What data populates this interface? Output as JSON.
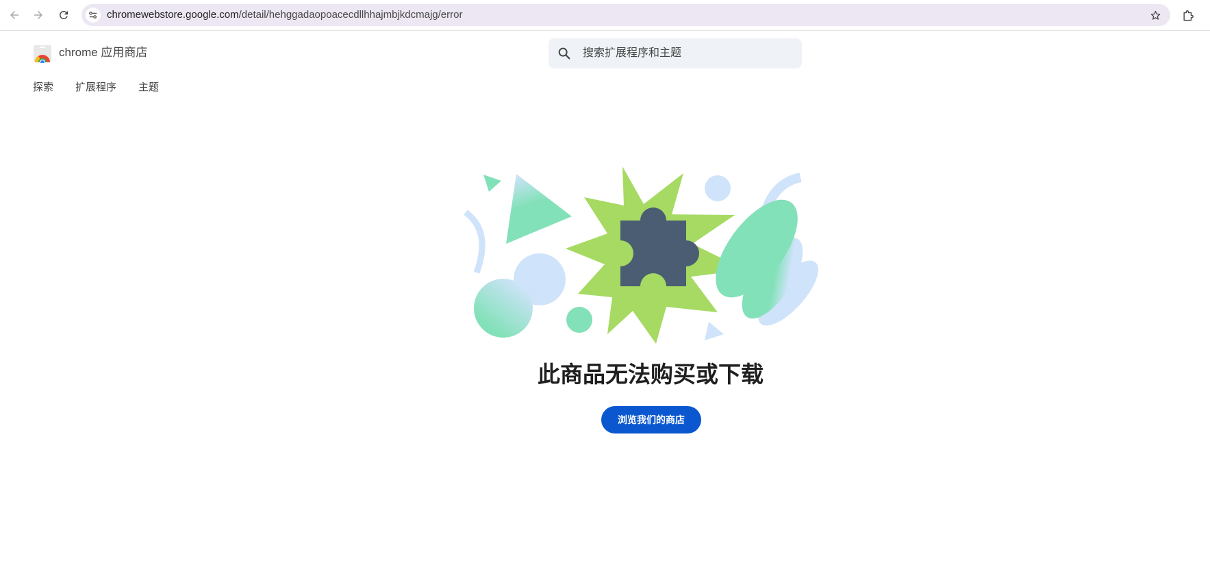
{
  "browser": {
    "url_host": "chromewebstore.google.com",
    "url_path": "/detail/hehggadaopoacecdllhhajmbjkdcmajg/error"
  },
  "store": {
    "name": "chrome 应用商店",
    "search_placeholder": "搜索扩展程序和主题",
    "nav": [
      {
        "label": "探索"
      },
      {
        "label": "扩展程序"
      },
      {
        "label": "主题"
      }
    ]
  },
  "error": {
    "title": "此商品无法购买或下载",
    "button_label": "浏览我们的商店"
  },
  "colors": {
    "accent": "#0b57d0",
    "green": "#a6da63",
    "puzzle": "#4a5d73",
    "mint": "#82e1b8",
    "light_blue": "#cfe3fa",
    "omnibox": "#ece7f3",
    "search_bg": "#eff2f6"
  },
  "icons": [
    "back-arrow-icon",
    "forward-arrow-icon",
    "reload-icon",
    "site-info-icon",
    "bookmark-star-icon",
    "extensions-icon",
    "chrome-web-store-logo",
    "search-icon",
    "puzzle-piece-icon"
  ]
}
